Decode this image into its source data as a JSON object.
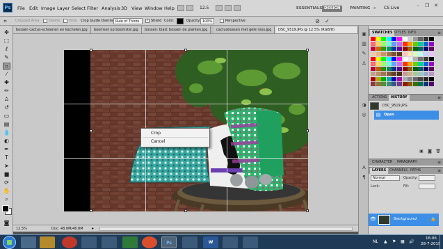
{
  "app": {
    "logo": "Ps",
    "menu": [
      "File",
      "Edit",
      "Image",
      "Layer",
      "Select",
      "Filter",
      "Analysis",
      "3D",
      "View",
      "Window",
      "Help"
    ],
    "zoom_select": "12.5",
    "workspaces": {
      "essentials": "ESSENTIALS",
      "design": "DESIGN",
      "painting": "PAINTING",
      "more": "»"
    },
    "cs_live": "CS Live",
    "window_buttons": {
      "minimize": "–",
      "restore": "❐",
      "close": "✕"
    }
  },
  "options_bar": {
    "cropped_area": "Cropped Area:",
    "delete": "Delete",
    "hide": "Hide",
    "overlay_label": "Crop Guide Overlay:",
    "overlay_value": "Rule of Thirds",
    "shield_label": "Shield",
    "color_label": "Color:",
    "opacity_label": "Opacity:",
    "opacity_value": "100%",
    "perspective_label": "Perspective"
  },
  "doc_tabs": [
    "bossen cactus-schoenen en kachelen.jpg",
    "boomset op boomstel.jpg",
    "bossen: blad: bossen de planten.jpg",
    "cactusbossen met gele roos.jpg",
    "DSC_9519.JPG @ 12.5% (RGB/8)"
  ],
  "context_menu": {
    "crop": "Crop",
    "cancel": "Cancel"
  },
  "status": {
    "zoom": "12.5%",
    "doc": "Doc: 48.8M/48.8M",
    "arrow": "▸"
  },
  "panels": {
    "swatches_tabs": [
      "SWATCHES",
      "STYLES",
      "INFO"
    ],
    "history_tabs": [
      "ACTIONS",
      "HISTORY"
    ],
    "history": {
      "snapshot": "DSC_9519.JPG",
      "state": "Open"
    },
    "char_tabs": [
      "CHARACTER",
      "PARAGRAPH"
    ],
    "layers_tabs": [
      "LAYERS",
      "CHANNELS",
      "PATHS"
    ],
    "layers": {
      "blend": "Normal",
      "opacity_label": "Opacity:",
      "lock_label": "Lock:",
      "fill_label": "Fill:",
      "layer_name": "Background"
    },
    "swatch_colors": [
      "#ff0000",
      "#ffff00",
      "#00ff00",
      "#00ffff",
      "#0000ff",
      "#ff00ff",
      "#ffffff",
      "#cccccc",
      "#999999",
      "#666666",
      "#333333",
      "#000000",
      "#ff6a6a",
      "#ffd36a",
      "#9bff6a",
      "#6affd7",
      "#6a9bff",
      "#c56aff",
      "#ff3300",
      "#ff9900",
      "#66cc00",
      "#00cc99",
      "#0066cc",
      "#9900cc",
      "#cc0033",
      "#cc6600",
      "#339900",
      "#009966",
      "#003399",
      "#660099",
      "#990000",
      "#996600",
      "#006600",
      "#006666",
      "#000066",
      "#660066",
      "#f5c9a6",
      "#e8b58a",
      "#c99566",
      "#a47248",
      "#7d5230",
      "#5c3a1e",
      "#ffc2c2",
      "#ffe7b8",
      "#d6ffc2",
      "#c2fff0",
      "#c2d6ff",
      "#ebc2ff"
    ]
  },
  "taskbar": {
    "apps": [
      "Ps",
      "W"
    ],
    "tray_lang": "NL",
    "time": "16:06",
    "date": "28-7-2015"
  }
}
